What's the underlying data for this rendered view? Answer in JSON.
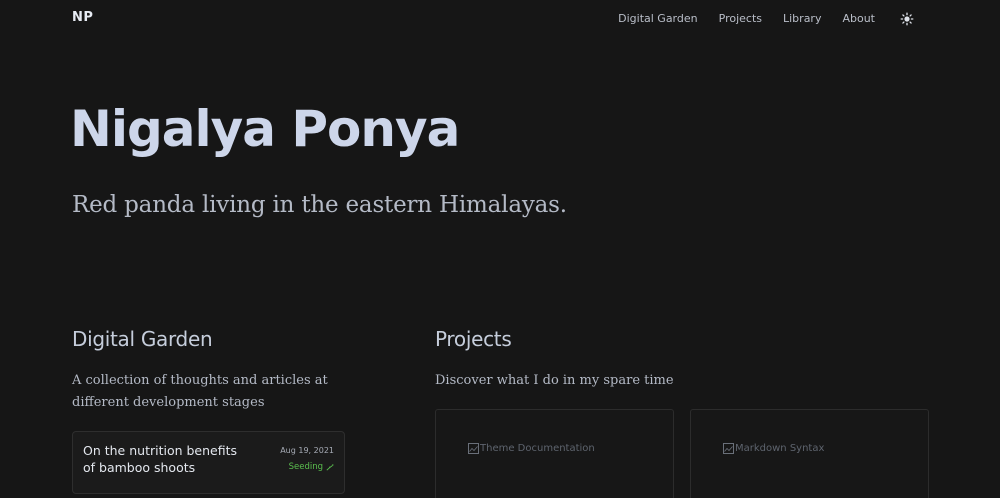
{
  "header": {
    "logo": "NP",
    "nav": [
      {
        "label": "Digital Garden"
      },
      {
        "label": "Projects"
      },
      {
        "label": "Library"
      },
      {
        "label": "About"
      }
    ],
    "theme_toggle_icon": "sun-icon"
  },
  "hero": {
    "title": "Nigalya Ponya",
    "subtitle": "Red panda living in the eastern Himalayas."
  },
  "garden": {
    "title": "Digital Garden",
    "description": "A collection of thoughts and articles at different development stages",
    "notes": [
      {
        "title": "On the nutrition benefits of bamboo shoots",
        "date": "Aug 19, 2021",
        "stage": "Seeding",
        "stage_icon": "sprout-icon",
        "stage_color": "#5bbf4f"
      }
    ]
  },
  "projects": {
    "title": "Projects",
    "description": "Discover what I do in my spare time",
    "items": [
      {
        "image_alt": "Theme Documentation"
      },
      {
        "image_alt": "Markdown Syntax"
      }
    ]
  },
  "colors": {
    "background": "#161616",
    "accent_green": "#5bbf4f",
    "heading": "#cdd6ea"
  }
}
